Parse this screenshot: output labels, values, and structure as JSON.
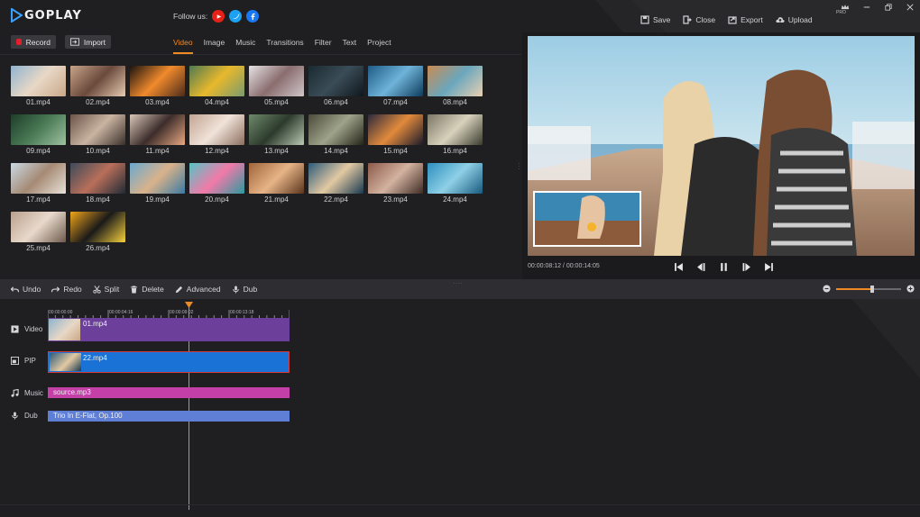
{
  "app": {
    "logo_text": "GOPLAY",
    "follow_label": "Follow us:",
    "social": [
      {
        "icon": "youtube-icon",
        "color": "#e62117"
      },
      {
        "icon": "twitter-icon",
        "color": "#1da1f2"
      },
      {
        "icon": "facebook-icon",
        "color": "#1877f2"
      }
    ],
    "actions": [
      {
        "label": "Save",
        "icon": "save-icon"
      },
      {
        "label": "Close",
        "icon": "close-project-icon"
      },
      {
        "label": "Export",
        "icon": "export-icon"
      },
      {
        "label": "Upload",
        "icon": "upload-icon"
      }
    ],
    "pro_label": "PRO"
  },
  "media": {
    "record_label": "Record",
    "import_label": "Import",
    "tabs": [
      "Video",
      "Image",
      "Music",
      "Transitions",
      "Filter",
      "Text",
      "Project"
    ],
    "active_tab": "Video",
    "items": [
      {
        "name": "01.mp4",
        "colors": [
          "#8fb3cf",
          "#e8d8c6",
          "#c9a787"
        ]
      },
      {
        "name": "02.mp4",
        "colors": [
          "#c8a48a",
          "#6b4a3c",
          "#e6cbb1"
        ]
      },
      {
        "name": "03.mp4",
        "colors": [
          "#1b1310",
          "#f08a2c",
          "#4a2b1b"
        ]
      },
      {
        "name": "04.mp4",
        "colors": [
          "#4f7a52",
          "#e8b82c",
          "#7a9b6e"
        ]
      },
      {
        "name": "05.mp4",
        "colors": [
          "#e6e2e4",
          "#8a6d6f",
          "#cfc6c8"
        ]
      },
      {
        "name": "06.mp4",
        "colors": [
          "#1b2a31",
          "#3a4c57",
          "#0f171c"
        ]
      },
      {
        "name": "07.mp4",
        "colors": [
          "#1e5b86",
          "#6fb3d9",
          "#0e3c5c"
        ]
      },
      {
        "name": "08.mp4",
        "colors": [
          "#c98a52",
          "#6aa7bd",
          "#e9cfb1"
        ]
      },
      {
        "name": "09.mp4",
        "colors": [
          "#1e3d2a",
          "#4a7a55",
          "#9fc2a1"
        ]
      },
      {
        "name": "10.mp4",
        "colors": [
          "#6b5448",
          "#c9b3a1",
          "#3a2f2a"
        ]
      },
      {
        "name": "11.mp4",
        "colors": [
          "#d9c7b9",
          "#3c2c2a",
          "#e9a882"
        ]
      },
      {
        "name": "12.mp4",
        "colors": [
          "#c2a594",
          "#f0e2d8",
          "#8b6e5e"
        ]
      },
      {
        "name": "13.mp4",
        "colors": [
          "#6e8a6a",
          "#2c3a2c",
          "#b9c9b3"
        ]
      },
      {
        "name": "14.mp4",
        "colors": [
          "#4a4a3a",
          "#9fa38a",
          "#242418"
        ]
      },
      {
        "name": "15.mp4",
        "colors": [
          "#2c2a3c",
          "#e28a3c",
          "#1a1a2a"
        ]
      },
      {
        "name": "16.mp4",
        "colors": [
          "#7a7565",
          "#d8d2bc",
          "#3a3a2e"
        ]
      },
      {
        "name": "17.mp4",
        "colors": [
          "#c9d9e4",
          "#a58a74",
          "#e9e2d9"
        ]
      },
      {
        "name": "18.mp4",
        "colors": [
          "#3c4a5a",
          "#b86f5a",
          "#1f2a36"
        ]
      },
      {
        "name": "19.mp4",
        "colors": [
          "#6aa9d0",
          "#d9b28a",
          "#3a7aa3"
        ]
      },
      {
        "name": "20.mp4",
        "colors": [
          "#56c4c6",
          "#f27aa8",
          "#2a9aa0"
        ]
      },
      {
        "name": "21.mp4",
        "colors": [
          "#a0643a",
          "#e6b487",
          "#5a341c"
        ]
      },
      {
        "name": "22.mp4",
        "colors": [
          "#2d5a7a",
          "#e2c9a2",
          "#18384f"
        ]
      },
      {
        "name": "23.mp4",
        "colors": [
          "#8c5a4a",
          "#d3b2a0",
          "#3e2a24"
        ]
      },
      {
        "name": "24.mp4",
        "colors": [
          "#2c8fbf",
          "#8fd0e6",
          "#17597d"
        ]
      },
      {
        "name": "25.mp4",
        "colors": [
          "#b9a08c",
          "#e8d9cc",
          "#6e5a4c"
        ]
      },
      {
        "name": "26.mp4",
        "colors": [
          "#f0a41a",
          "#1a1a1a",
          "#f7d23c"
        ]
      }
    ]
  },
  "preview": {
    "time": "00:00:08:12 / 00:00:14:05",
    "controls": [
      "skip-back-icon",
      "step-back-icon",
      "pause-icon",
      "step-forward-icon",
      "skip-forward-icon"
    ]
  },
  "edit": {
    "tools": [
      {
        "label": "Undo",
        "icon": "undo-icon"
      },
      {
        "label": "Redo",
        "icon": "redo-icon"
      },
      {
        "label": "Split",
        "icon": "scissors-icon"
      },
      {
        "label": "Delete",
        "icon": "trash-icon"
      },
      {
        "label": "Advanced",
        "icon": "pencil-icon"
      },
      {
        "label": "Dub",
        "icon": "microphone-icon"
      }
    ],
    "zoom_level": 0.55
  },
  "timeline": {
    "ruler": [
      "00:00:00:00",
      "00:00:04:16",
      "00:00:09:02",
      "00:00:13:18"
    ],
    "tracks": [
      {
        "label": "Video",
        "icon": "video-track-icon",
        "clip": "01.mp4",
        "color": "#6b3f9a"
      },
      {
        "label": "PIP",
        "icon": "pip-track-icon",
        "clip": "22.mp4",
        "color": "#1a72d6"
      },
      {
        "label": "Music",
        "icon": "music-note-icon",
        "clip": "source.mp3",
        "color": "#c43fa8"
      },
      {
        "label": "Dub",
        "icon": "microphone-icon",
        "clip": "Trio In E-Flat, Op.100",
        "color": "#5f7fd6"
      }
    ],
    "accent": "#f08a24"
  }
}
